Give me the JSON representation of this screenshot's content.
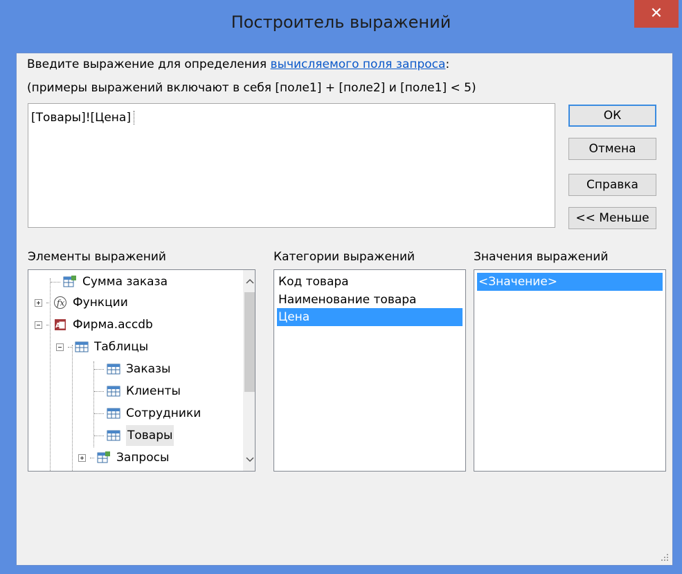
{
  "window": {
    "title": "Построитель выражений",
    "close_label": "✕"
  },
  "prompt": {
    "line1_prefix": "Введите выражение для определения ",
    "line1_link": "вычисляемого поля запроса",
    "line1_suffix": ":",
    "line2": "(примеры выражений включают в себя [поле1] + [поле2] и [поле1] < 5)"
  },
  "expression": {
    "value": "[Товары]![Цена]"
  },
  "buttons": {
    "ok": "ОК",
    "cancel": "Отмена",
    "help": "Справка",
    "less": "<< Меньше"
  },
  "panels": {
    "elements_label": "Элементы выражений",
    "categories_label": "Категории выражений",
    "values_label": "Значения выражений"
  },
  "tree": {
    "items": [
      {
        "label": "Сумма заказа",
        "icon": "query-icon"
      },
      {
        "label": "Функции",
        "icon": "function-icon"
      },
      {
        "label": "Фирма.accdb",
        "icon": "access-database-icon"
      },
      {
        "label": "Таблицы",
        "icon": "table-icon"
      },
      {
        "label": "Заказы",
        "icon": "table-icon"
      },
      {
        "label": "Клиенты",
        "icon": "table-icon"
      },
      {
        "label": "Сотрудники",
        "icon": "table-icon"
      },
      {
        "label": "Товары",
        "icon": "table-icon",
        "selected": true
      },
      {
        "label": "Запросы",
        "icon": "query-icon"
      }
    ]
  },
  "categories": {
    "items": [
      "Код товара",
      "Наименование товара",
      "Цена"
    ],
    "selected": "Цена"
  },
  "values": {
    "items": [
      "<Значение>"
    ],
    "selected": "<Значение>"
  },
  "colors": {
    "title_bar": "#5b8de0",
    "close_button": "#c74b3f",
    "selection": "#3399ff",
    "link": "#0a58ca"
  }
}
